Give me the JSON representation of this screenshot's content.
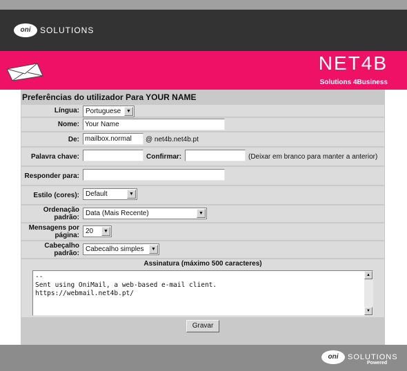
{
  "header": {
    "brand_oval": "oni",
    "brand_text": "SOLUTIONS",
    "net4b_logo": "NET4B",
    "net4b_tagline": "Solutions 4Business",
    "envelope_icon": "envelope-icon"
  },
  "form": {
    "title": "Preferências do utilizador Para YOUR NAME",
    "language": {
      "label": "Língua:",
      "value": "Portuguese"
    },
    "name": {
      "label": "Nome:",
      "value": "Your Name"
    },
    "from": {
      "label": "De:",
      "value": "mailbox.normal",
      "domain": "@ net4b.net4b.pt"
    },
    "password": {
      "label": "Palavra chave:",
      "confirm_label": "Confirmar:",
      "hint": "(Deixar em branco para manter a anterior)"
    },
    "reply_to": {
      "label": "Responder para:",
      "value": ""
    },
    "style": {
      "label": "Estilo (cores):",
      "value": "Default"
    },
    "sort": {
      "label": "Ordenação padrão:",
      "value": "Data (Mais Recente)"
    },
    "per_page": {
      "label": "Mensagens por página:",
      "value": "20"
    },
    "header_mode": {
      "label": "Cabeçalho padrão:",
      "value": "Cabecalho simples"
    },
    "signature": {
      "label": "Assinatura (máximo 500 caracteres)",
      "value": "--\nSent using OniMail, a web-based e-mail client.\nhttps://webmail.net4b.pt/"
    },
    "save_label": "Gravar"
  },
  "footer": {
    "brand_oval": "oni",
    "brand_text": "SOLUTIONS",
    "powered": "Powered"
  },
  "colors": {
    "accent_pink": "#ee1166",
    "header_dark": "#333333",
    "form_bg": "#c9c9c9",
    "row_bg": "#dcdcdc"
  }
}
